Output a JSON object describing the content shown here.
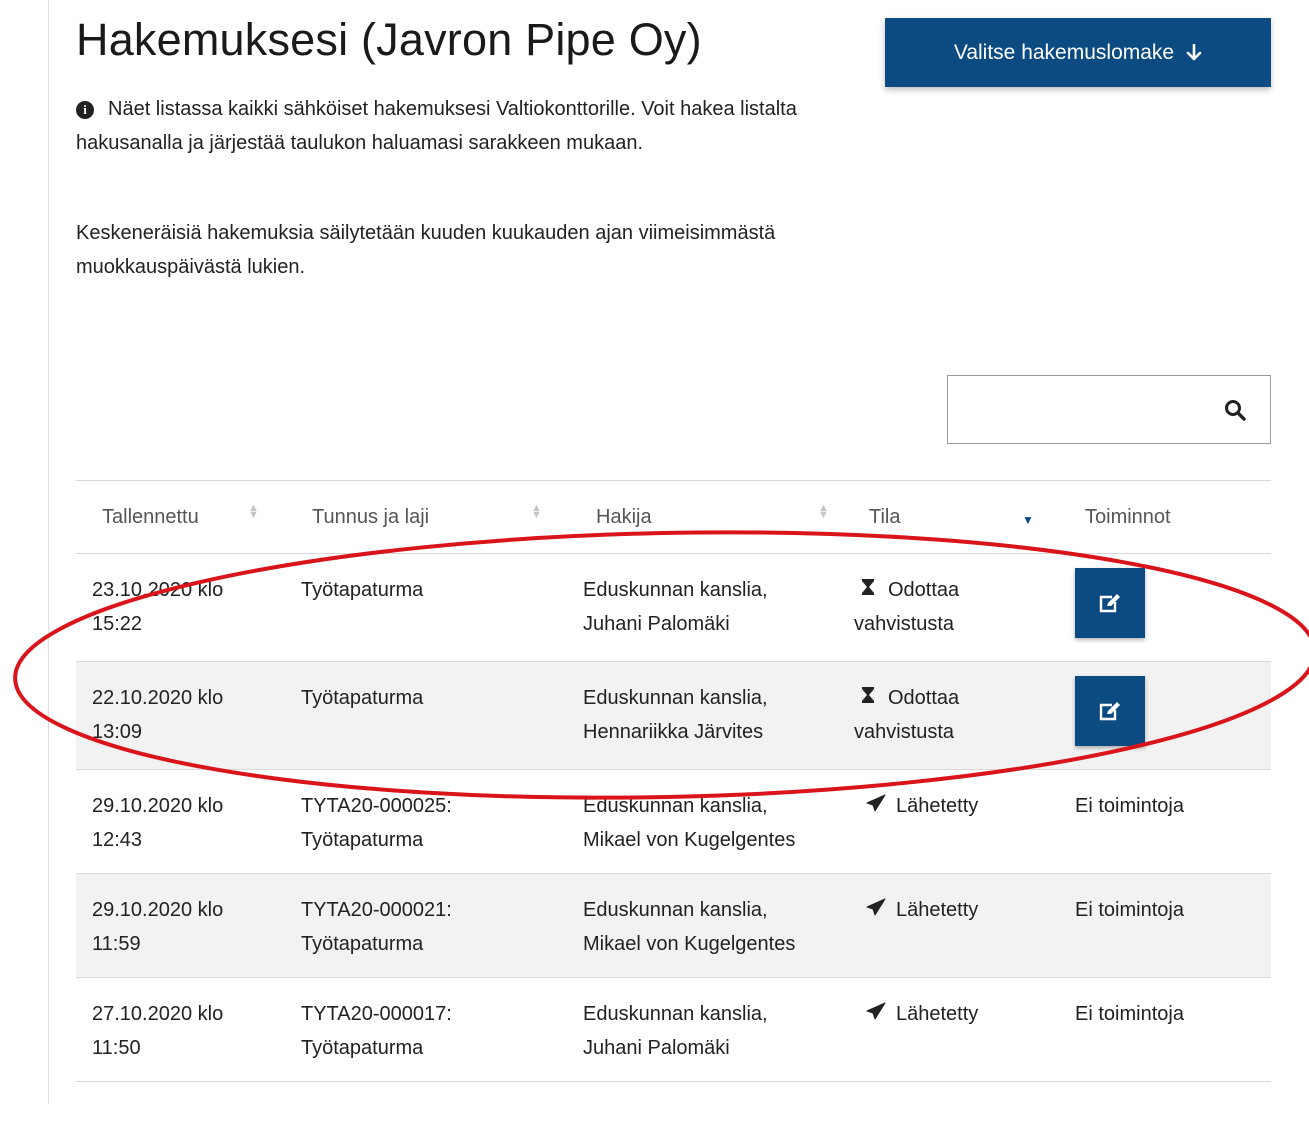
{
  "page": {
    "title": "Hakemuksesi (Javron Pipe Oy)",
    "primary_button": "Valitse hakemuslomake",
    "intro": "Näet listassa kaikki sähköiset hakemuksesi Valtiokonttorille. Voit hakea listalta hakusanalla ja järjestää taulukon haluamasi sarakkeen mukaan.",
    "note": "Keskeneräisiä hakemuksia säilytetään kuuden kuukauden ajan viimeisimmästä muokkauspäivästä lukien.",
    "search": {
      "value": "",
      "placeholder": ""
    }
  },
  "table": {
    "headers": [
      "Tallennettu",
      "Tunnus ja laji",
      "Hakija",
      "Tila",
      "Toiminnot"
    ],
    "rows": [
      {
        "saved_line1": "23.10.2020 klo",
        "saved_line2": "15:22",
        "id_line1": "Työtapaturma",
        "id_line2": "",
        "applicant_line1": "Eduskunnan kanslia,",
        "applicant_line2": "Juhani Palomäki",
        "status_line1": "Odottaa",
        "status_line2": "vahvistusta",
        "status_icon": "hourglass-icon",
        "action": "edit"
      },
      {
        "saved_line1": "22.10.2020 klo",
        "saved_line2": "13:09",
        "id_line1": "Työtapaturma",
        "id_line2": "",
        "applicant_line1": "Eduskunnan kanslia,",
        "applicant_line2": "Hennariikka Järvites",
        "status_line1": "Odottaa",
        "status_line2": "vahvistusta",
        "status_icon": "hourglass-icon",
        "action": "edit"
      },
      {
        "saved_line1": "29.10.2020 klo",
        "saved_line2": "12:43",
        "id_line1": "TYTA20-000025:",
        "id_line2": "Työtapaturma",
        "applicant_line1": "Eduskunnan kanslia,",
        "applicant_line2": "Mikael von Kugelgentes",
        "status_line1": "Lähetetty",
        "status_line2": "",
        "status_icon": "send-icon",
        "action": "Ei toimintoja"
      },
      {
        "saved_line1": "29.10.2020 klo",
        "saved_line2": "11:59",
        "id_line1": "TYTA20-000021:",
        "id_line2": "Työtapaturma",
        "applicant_line1": "Eduskunnan kanslia,",
        "applicant_line2": "Mikael von Kugelgentes",
        "status_line1": "Lähetetty",
        "status_line2": "",
        "status_icon": "send-icon",
        "action": "Ei toimintoja"
      },
      {
        "saved_line1": "27.10.2020 klo",
        "saved_line2": "11:50",
        "id_line1": "TYTA20-000017:",
        "id_line2": "Työtapaturma",
        "applicant_line1": "Eduskunnan kanslia,",
        "applicant_line2": "Juhani Palomäki",
        "status_line1": "Lähetetty",
        "status_line2": "",
        "status_icon": "send-icon",
        "action": "Ei toimintoja"
      }
    ]
  },
  "colors": {
    "primary": "#0c4a82",
    "annotation": "#d9151b",
    "row_shade": "#f2f2f2"
  }
}
